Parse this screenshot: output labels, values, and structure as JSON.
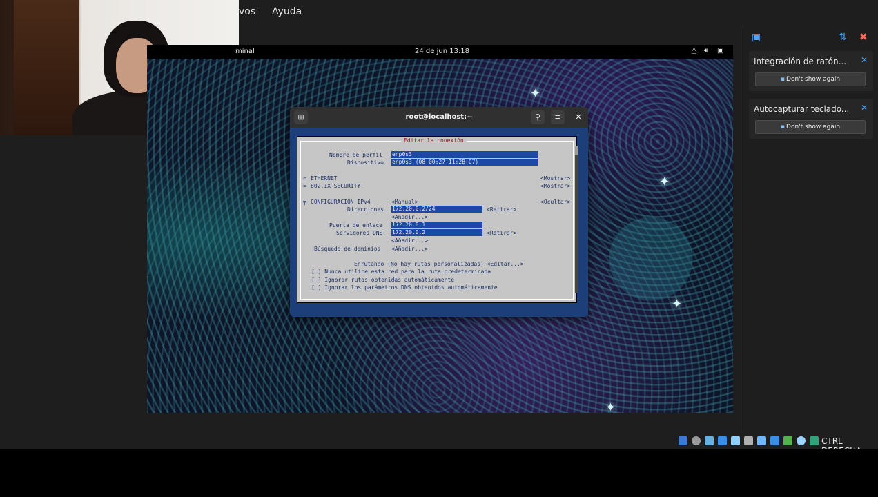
{
  "menubar": {
    "archivo": "vos",
    "ayuda": "Ayuda"
  },
  "vm": {
    "topbar": {
      "app": "minal",
      "clock": "24 de jun  13:18"
    },
    "terminal": {
      "title": "root@localhost:~",
      "tui": {
        "title": "Editar la conexión",
        "profile_label": "Nombre de perfil",
        "profile_value": "enp0s3",
        "device_label": "Dispositivo",
        "device_value": "enp0s3 (08:00:27:11:2B:C7)",
        "ethernet": "ETHERNET",
        "security": "802.1X SECURITY",
        "mostrar1": "<Mostrar>",
        "mostrar2": "<Mostrar>",
        "ipv4_label": "CONFIGURACIÓN IPv4",
        "ipv4_mode": "<Manual>",
        "ocultar": "<Ocultar>",
        "addr_label": "Direcciones",
        "addr_value": "172.20.0.2/24",
        "retirar1": "<Retirar>",
        "anadir1": "<Añadir...>",
        "gateway_label": "Puerta de enlace",
        "gateway_value": "172.20.0.1",
        "dns_label": "Servidores DNS",
        "dns_value": "172.20.0.2",
        "retirar2": "<Retirar>",
        "anadir2": "<Añadir...>",
        "search_label": "Búsqueda de dominios",
        "anadir3": "<Añadir...>",
        "routing": "Enrutando (No hay rutas personalizadas) <Editar...>",
        "check1": "[ ] Nunca utilice esta red para la ruta predeterminada",
        "check2": "[ ] Ignorar rutas obtenidas automáticamente",
        "check3": "[ ] Ignorar los parámetros DNS obtenidos automáticamente"
      }
    }
  },
  "notifications": [
    {
      "title": "Integración de ratón...",
      "button": "Don't show again"
    },
    {
      "title": "Autocapturar teclado...",
      "button": "Don't show again"
    }
  ],
  "statusbar": {
    "hostkey": "CTRL DERECHA"
  },
  "colors": {
    "accent": "#4aa3ff",
    "tui_field": "#1d49a6",
    "terminal_bg": "#1c3f7a"
  }
}
